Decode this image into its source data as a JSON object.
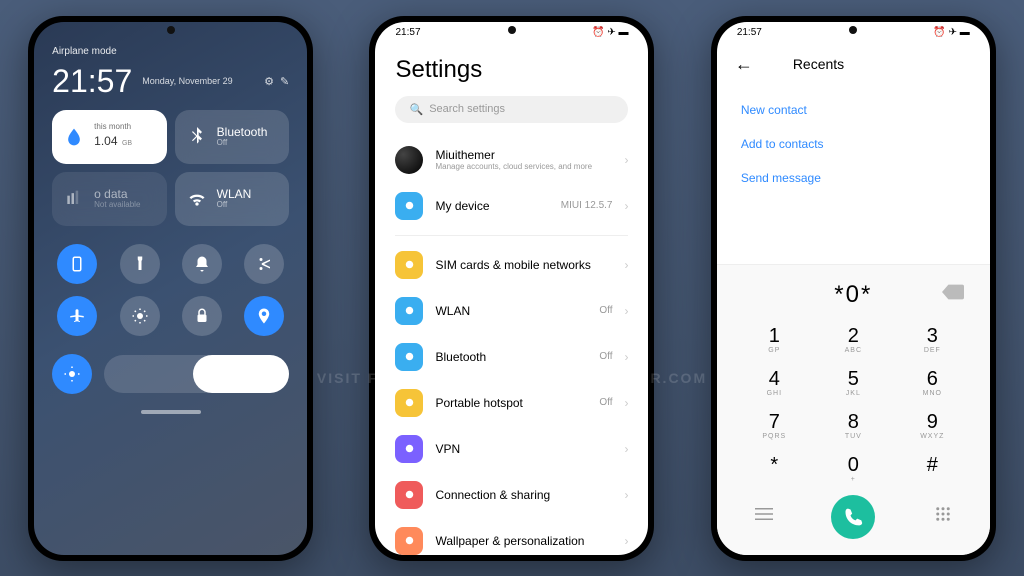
{
  "status": {
    "time": "21:57",
    "icons": "⏰ ✈ ▬"
  },
  "cc": {
    "mode": "Airplane mode",
    "time": "21:57",
    "date": "Monday, November 29",
    "data_label": "this month",
    "data_value": "1.04",
    "data_unit": "GB",
    "bt_label": "Bluetooth",
    "bt_state": "Off",
    "sim_label": "o data",
    "sim_sub": "Not available",
    "wlan_label": "WLAN",
    "wlan_state": "Off"
  },
  "settings": {
    "title": "Settings",
    "search_ph": "Search settings",
    "account": {
      "name": "Miuithemer",
      "sub": "Manage accounts, cloud services, and more"
    },
    "items": [
      {
        "label": "My device",
        "value": "MIUI 12.5.7",
        "color": "#3aaef0"
      },
      {
        "label": "SIM cards & mobile networks",
        "value": "",
        "color": "#f6c438"
      },
      {
        "label": "WLAN",
        "value": "Off",
        "color": "#3aaef0"
      },
      {
        "label": "Bluetooth",
        "value": "Off",
        "color": "#3aaef0"
      },
      {
        "label": "Portable hotspot",
        "value": "Off",
        "color": "#f6c438"
      },
      {
        "label": "VPN",
        "value": "",
        "color": "#7b61ff"
      },
      {
        "label": "Connection & sharing",
        "value": "",
        "color": "#ef5b5b"
      },
      {
        "label": "Wallpaper & personalization",
        "value": "",
        "color": "#ff8a5b"
      }
    ]
  },
  "dialer": {
    "title": "Recents",
    "actions": [
      "New contact",
      "Add to contacts",
      "Send message"
    ],
    "input": "*0*",
    "keys": [
      {
        "n": "1",
        "s": "GP"
      },
      {
        "n": "2",
        "s": "ABC"
      },
      {
        "n": "3",
        "s": "DEF"
      },
      {
        "n": "4",
        "s": "GHI"
      },
      {
        "n": "5",
        "s": "JKL"
      },
      {
        "n": "6",
        "s": "MNO"
      },
      {
        "n": "7",
        "s": "PQRS"
      },
      {
        "n": "8",
        "s": "TUV"
      },
      {
        "n": "9",
        "s": "WXYZ"
      },
      {
        "n": "*",
        "s": ""
      },
      {
        "n": "0",
        "s": "+"
      },
      {
        "n": "#",
        "s": ""
      }
    ]
  },
  "watermark": "VISIT FOR MORE THEMES - MIUITHEMER.COM"
}
